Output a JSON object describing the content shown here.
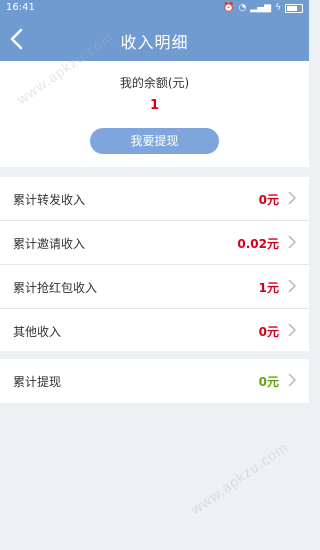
{
  "status": {
    "time": "16:41"
  },
  "nav": {
    "title": "收入明细"
  },
  "balance": {
    "label": "我的余额(元)",
    "value": "1",
    "button": "我要提现"
  },
  "rows": [
    {
      "label": "累计转发收入",
      "amount": "0元",
      "color": "#d0021b"
    },
    {
      "label": "累计邀请收入",
      "amount": "0.02元",
      "color": "#d0021b"
    },
    {
      "label": "累计抢红包收入",
      "amount": "1元",
      "color": "#d0021b"
    },
    {
      "label": "其他收入",
      "amount": "0元",
      "color": "#d0021b"
    }
  ],
  "withdrawTotal": {
    "label": "累计提现",
    "amount": "0元",
    "color": "#5ea410"
  },
  "watermark": "www.apkzu.com"
}
